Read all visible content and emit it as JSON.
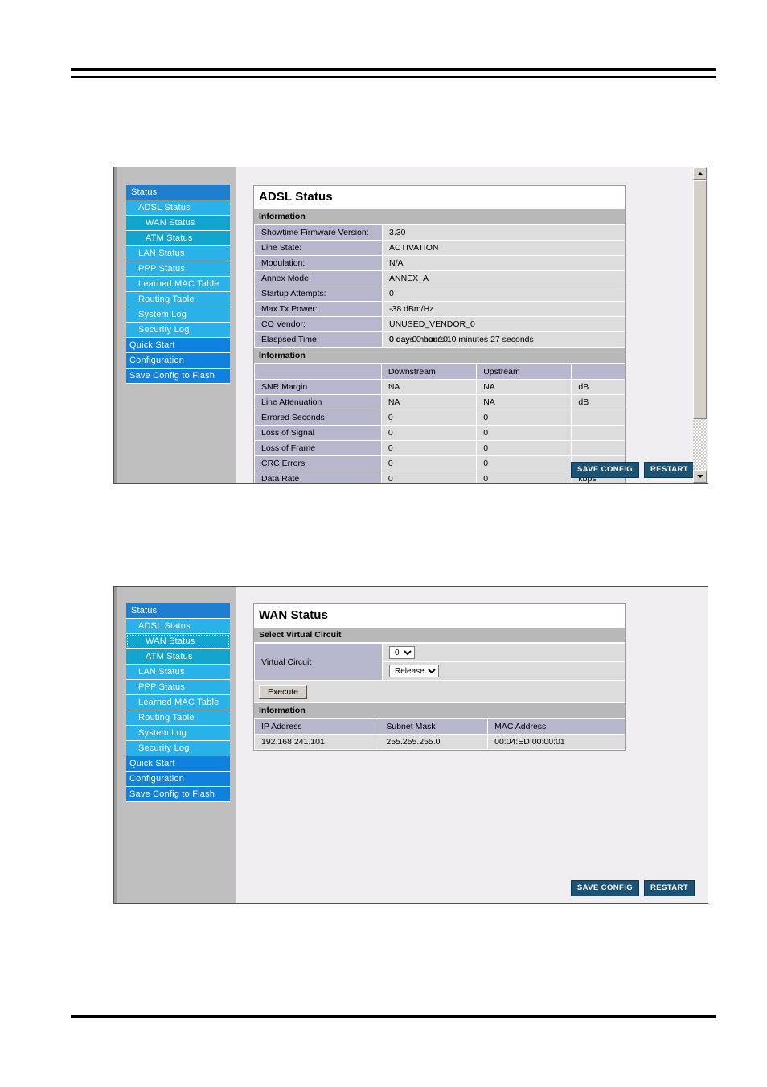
{
  "sidebar": {
    "items": [
      {
        "label": "Status",
        "level": "top"
      },
      {
        "label": "ADSL Status",
        "level": "sub1"
      },
      {
        "label": "WAN Status",
        "level": "sub2"
      },
      {
        "label": "ATM Status",
        "level": "sub3"
      },
      {
        "label": "LAN Status",
        "level": "sub"
      },
      {
        "label": "PPP Status",
        "level": "sub"
      },
      {
        "label": "Learned MAC Table",
        "level": "sub"
      },
      {
        "label": "Routing Table",
        "level": "sub"
      },
      {
        "label": "System Log",
        "level": "sub"
      },
      {
        "label": "Security Log",
        "level": "sub"
      },
      {
        "label": "Quick Start",
        "level": "main"
      },
      {
        "label": "Configuration",
        "level": "main"
      },
      {
        "label": "Save Config to Flash",
        "level": "main"
      }
    ]
  },
  "adsl": {
    "title": "ADSL Status",
    "section1_label": "Information",
    "section2_label": "Information",
    "info_rows": [
      {
        "label": "Showtime Firmware Version:",
        "value": "3.30"
      },
      {
        "label": "Line State:",
        "value": "ACTIVATION"
      },
      {
        "label": "Modulation:",
        "value": "N/A"
      },
      {
        "label": "Annex Mode:",
        "value": "ANNEX_A"
      },
      {
        "label": "Startup Attempts:",
        "value": "0"
      },
      {
        "label": "Max Tx Power:",
        "value": "-38 dBm/Hz"
      },
      {
        "label": "CO Vendor:",
        "value": "UNUSED_VENDOR_0"
      }
    ],
    "elapsed_label": "Elaspsed Time:",
    "elapsed_value_a": "0 days 0 hours 10 minutes 27 seconds",
    "elapsed_value_b": "0 day 0 hour 10",
    "stats_headers": [
      "",
      "Downstream",
      "Upstream",
      ""
    ],
    "stats_rows": [
      {
        "label": "SNR Margin",
        "down": "NA",
        "up": "NA",
        "unit": "dB"
      },
      {
        "label": "Line Attenuation",
        "down": "NA",
        "up": "NA",
        "unit": "dB"
      },
      {
        "label": "Errored Seconds",
        "down": "0",
        "up": "0",
        "unit": ""
      },
      {
        "label": "Loss of Signal",
        "down": "0",
        "up": "0",
        "unit": ""
      },
      {
        "label": "Loss of Frame",
        "down": "0",
        "up": "0",
        "unit": ""
      },
      {
        "label": "CRC Errors",
        "down": "0",
        "up": "0",
        "unit": ""
      },
      {
        "label": "Data Rate",
        "down": "0",
        "up": "0",
        "unit": "kbps"
      }
    ]
  },
  "wan": {
    "title": "WAN Status",
    "section1_label": "Select Virtual Circuit",
    "section2_label": "Information",
    "vc_label": "Virtual Circuit",
    "vc_value": "0",
    "vc_options": [
      "0"
    ],
    "action_value": "Release",
    "action_options": [
      "Release"
    ],
    "execute_label": "Execute",
    "table_headers": [
      "IP Address",
      "Subnet Mask",
      "MAC Address"
    ],
    "table_rows": [
      [
        "192.168.241.101",
        "255.255.255.0",
        "00:04:ED:00:00:01"
      ]
    ]
  },
  "actions": {
    "save_config_label": "SAVE CONFIG",
    "restart_label": "RESTART"
  },
  "colors": {
    "nav_top": "#1e7fd1",
    "nav_sub1": "#29b2e8",
    "nav_sub2": "#11a5cd",
    "nav_main": "#0f82e0",
    "label_cell": "#b6b6cd",
    "value_cell": "#dcdcdc",
    "section_bar": "#b8b8b8",
    "button_blue": "#1c5274",
    "sidebar_bg": "#bfbfbf",
    "panel_bg": "#f0eef1"
  }
}
